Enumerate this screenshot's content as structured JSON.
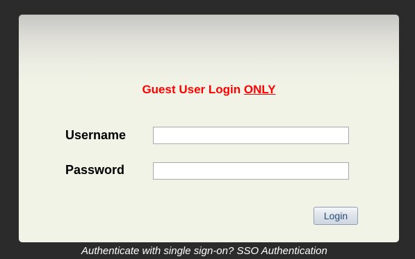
{
  "login": {
    "title": "Guest User Login",
    "title_emphasis": "ONLY",
    "username_label": "Username",
    "username_value": "",
    "password_label": "Password",
    "password_value": "",
    "login_button": "Login"
  },
  "footer": {
    "prompt": "Authenticate with single sign-on?",
    "sso_link": "SSO Authentication"
  }
}
